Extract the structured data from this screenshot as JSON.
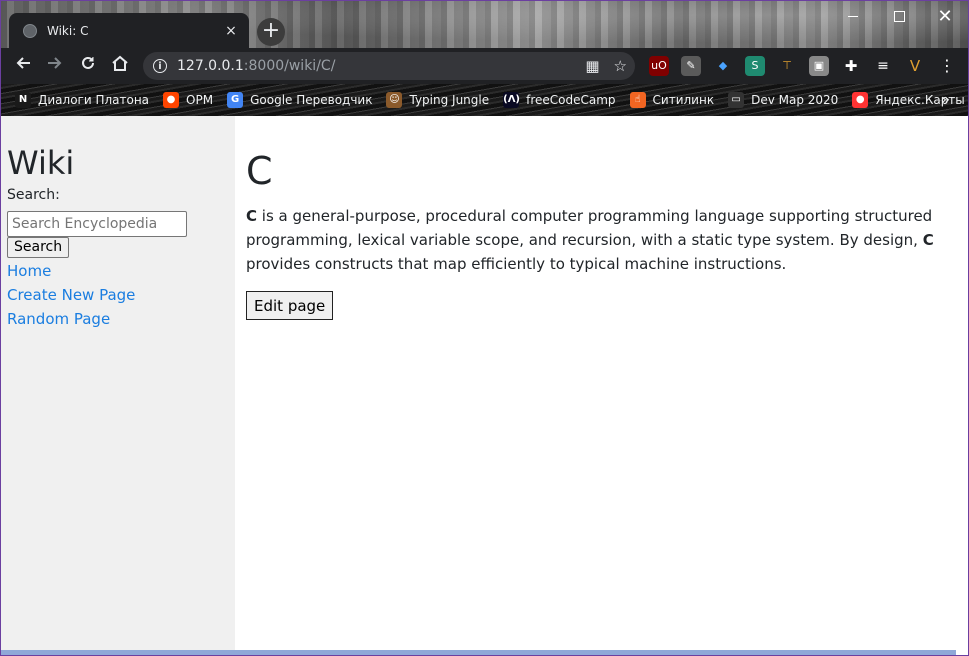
{
  "browser": {
    "tab_title": "Wiki: C",
    "tab_close": "×",
    "new_tab": "+",
    "url_host": "127.0.0.1",
    "url_path": ":8000/wiki/C/",
    "bookmarks": [
      {
        "label": "Диалоги Платона",
        "icon": "n-icon",
        "color": "#1a1a1a",
        "glyph": "N"
      },
      {
        "label": "OPM",
        "icon": "reddit-icon",
        "color": "#ff4500",
        "glyph": "●"
      },
      {
        "label": "Google Переводчик",
        "icon": "google-translate-icon",
        "color": "#4285f4",
        "glyph": "G"
      },
      {
        "label": "Typing Jungle",
        "icon": "typing-jungle-icon",
        "color": "#8b5a2b",
        "glyph": "☺"
      },
      {
        "label": "freeCodeCamp",
        "icon": "freecodecamp-icon",
        "color": "#0a0a23",
        "glyph": "(Λ)"
      },
      {
        "label": "Ситилинк",
        "icon": "citilink-icon",
        "color": "#f26522",
        "glyph": "☝"
      },
      {
        "label": "Dev Map 2020",
        "icon": "devmap-icon",
        "color": "#333333",
        "glyph": "▭"
      },
      {
        "label": "Яндекс.Карты",
        "icon": "yandex-maps-icon",
        "color": "#ff3333",
        "glyph": "●"
      }
    ],
    "bookmarks_more": "»"
  },
  "sidebar": {
    "title": "Wiki",
    "search_label": "Search:",
    "search_placeholder": "Search Encyclopedia",
    "search_button": "Search",
    "links": [
      "Home",
      "Create New Page",
      "Random Page"
    ]
  },
  "article": {
    "title": "C",
    "bold_term": "C",
    "text_part1": " is a general-purpose, procedural computer programming language supporting structured programming, lexical variable scope, and recursion, with a static type system. By design, ",
    "text_part2": " provides constructs that map efficiently to typical machine instructions.",
    "edit_button": "Edit page"
  },
  "colors": {
    "link": "#1a7de0",
    "sidebar_bg": "#f0f0f0",
    "chrome_dark": "#202124"
  }
}
